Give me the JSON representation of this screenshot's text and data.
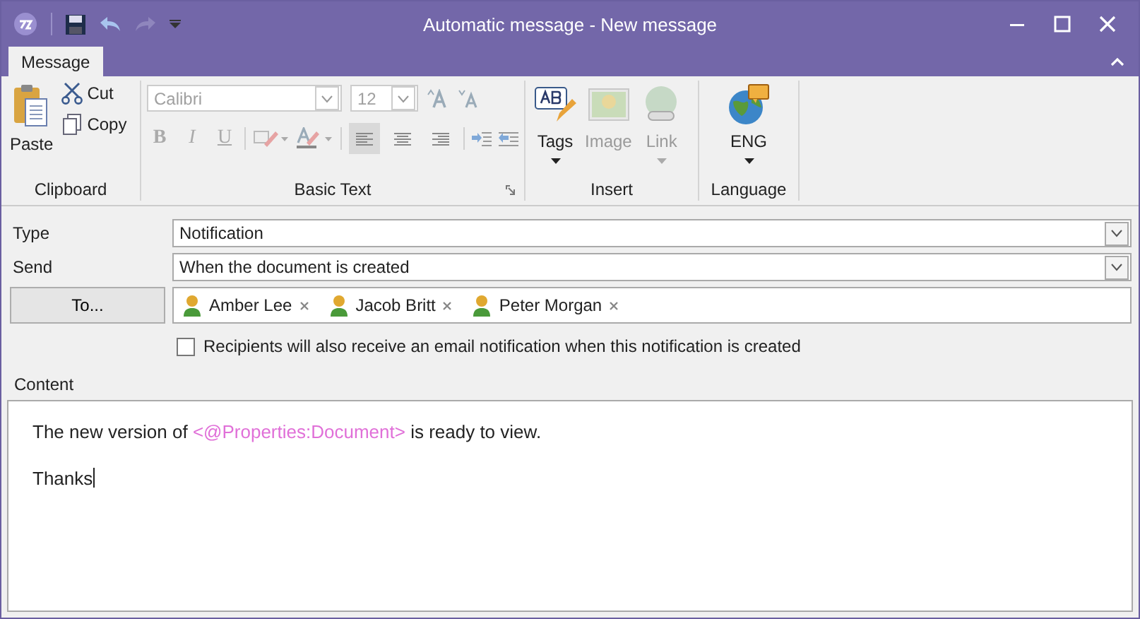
{
  "window": {
    "title": "Automatic message - New message"
  },
  "tabs": [
    {
      "label": "Message",
      "selected": true
    }
  ],
  "ribbon": {
    "clipboard": {
      "label": "Clipboard",
      "paste": "Paste",
      "cut": "Cut",
      "copy": "Copy"
    },
    "basic_text": {
      "label": "Basic Text",
      "font": "Calibri",
      "size": "12",
      "disabled": true,
      "styles": [
        {
          "label": "B",
          "kind": "bold"
        },
        {
          "label": "I",
          "kind": "italic"
        },
        {
          "label": "U",
          "kind": "underline"
        }
      ],
      "alignment": [
        {
          "kind": "left",
          "selected": true
        },
        {
          "kind": "center",
          "selected": false
        },
        {
          "kind": "right",
          "selected": false
        }
      ]
    },
    "insert": {
      "label": "Insert",
      "items": [
        {
          "label": "Tags",
          "kind": "tags",
          "disabled": false
        },
        {
          "label": "Image",
          "kind": "image",
          "disabled": true
        },
        {
          "label": "Link",
          "kind": "link",
          "disabled": true
        }
      ]
    },
    "language": {
      "label": "Language",
      "value": "ENG"
    }
  },
  "form": {
    "type": {
      "label": "Type",
      "value": "Notification"
    },
    "send": {
      "label": "Send",
      "value": "When the document is created"
    },
    "to_button": "To...",
    "recipients": [
      {
        "name": "Amber Lee"
      },
      {
        "name": "Jacob Britt"
      },
      {
        "name": "Peter Morgan"
      }
    ],
    "email_notify": {
      "label": "Recipients will also receive an email notification when this notification is created",
      "checked": false
    }
  },
  "content": {
    "label": "Content",
    "paragraphs": [
      [
        {
          "kind": "text",
          "text": "The new version of "
        },
        {
          "kind": "field",
          "text": "<@Properties:Document>"
        },
        {
          "kind": "text",
          "text": " is ready to view."
        }
      ],
      [
        {
          "kind": "text",
          "text": "Thanks"
        }
      ]
    ]
  }
}
